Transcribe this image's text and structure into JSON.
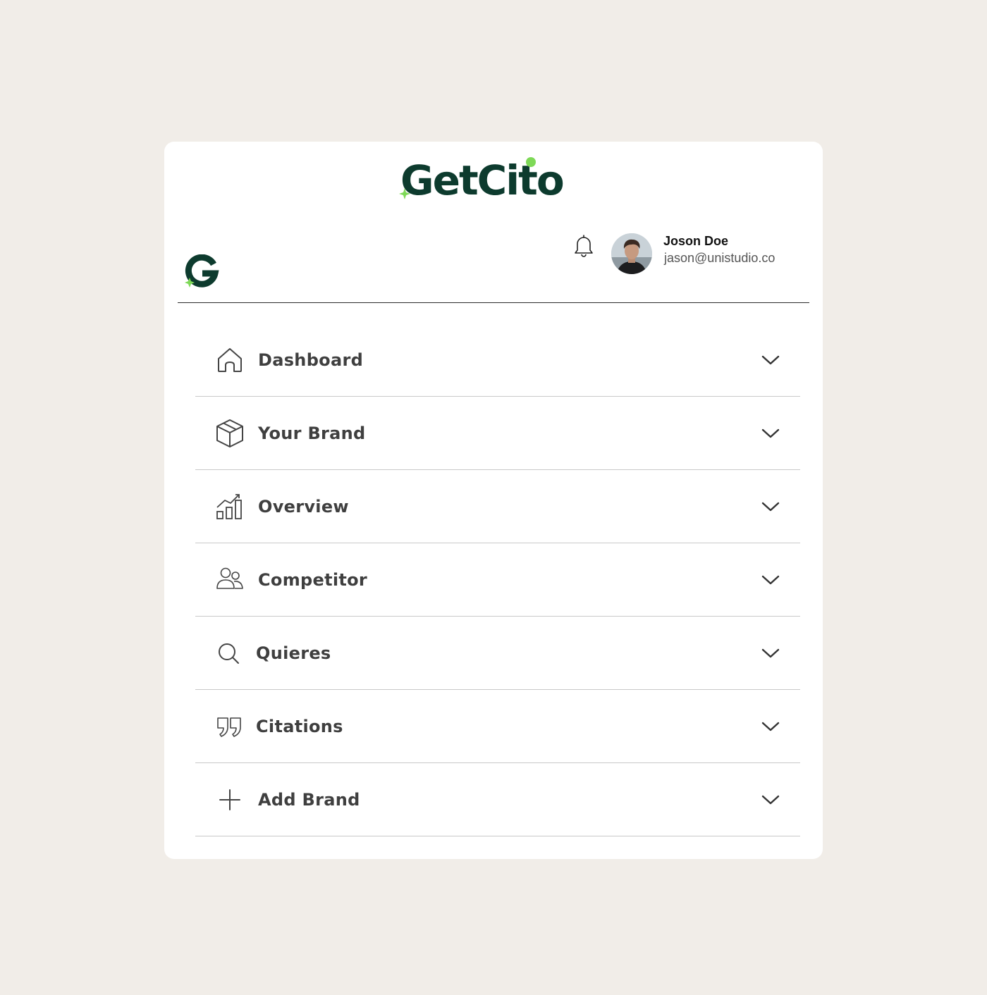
{
  "app": {
    "logo_text": "GetCito"
  },
  "user": {
    "name": "Joson Doe",
    "email": "jason@unistudio.co"
  },
  "nav": {
    "items": [
      {
        "label": "Dashboard",
        "icon": "home-icon"
      },
      {
        "label": "Your Brand",
        "icon": "box-icon"
      },
      {
        "label": "Overview",
        "icon": "bar-chart-icon"
      },
      {
        "label": "Competitor",
        "icon": "users-icon"
      },
      {
        "label": "Quieres",
        "icon": "search-icon"
      },
      {
        "label": "Citations",
        "icon": "quote-icon"
      },
      {
        "label": "Add Brand",
        "icon": "plus-icon"
      }
    ]
  },
  "colors": {
    "background": "#f1ede8",
    "card": "#ffffff",
    "brand_dark_green": "#0d3b2e",
    "brand_accent_green": "#7ed957",
    "nav_text": "#3f3f3f",
    "divider": "#c9c9c9"
  }
}
